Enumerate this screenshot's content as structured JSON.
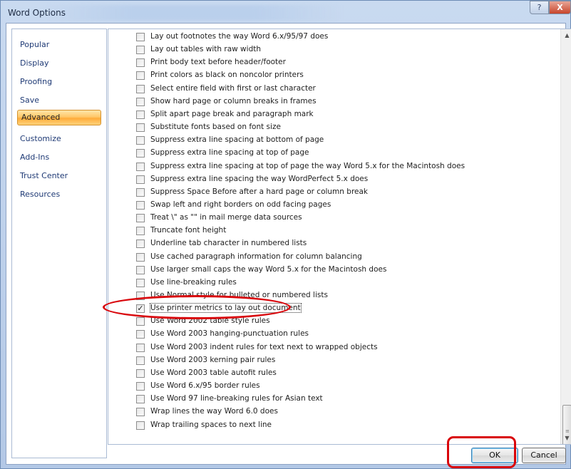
{
  "window": {
    "title": "Word Options",
    "help_glyph": "?",
    "close_glyph": "X"
  },
  "nav": {
    "items": [
      {
        "label": "Popular"
      },
      {
        "label": "Display"
      },
      {
        "label": "Proofing"
      },
      {
        "label": "Save"
      },
      {
        "label": "Advanced",
        "selected": true
      },
      {
        "label": "Customize"
      },
      {
        "label": "Add-Ins"
      },
      {
        "label": "Trust Center"
      },
      {
        "label": "Resources"
      }
    ]
  },
  "options": [
    {
      "label": "Lay out footnotes the way Word 6.x/95/97 does",
      "checked": false
    },
    {
      "label": "Lay out tables with raw width",
      "checked": false
    },
    {
      "label": "Print body text before header/footer",
      "checked": false
    },
    {
      "label": "Print colors as black on noncolor printers",
      "checked": false
    },
    {
      "label": "Select entire field with first or last character",
      "checked": false
    },
    {
      "label": "Show hard page or column breaks in frames",
      "checked": false
    },
    {
      "label": "Split apart page break and paragraph mark",
      "checked": false
    },
    {
      "label": "Substitute fonts based on font size",
      "checked": false
    },
    {
      "label": "Suppress extra line spacing at bottom of page",
      "checked": false
    },
    {
      "label": "Suppress extra line spacing at top of page",
      "checked": false
    },
    {
      "label": "Suppress extra line spacing at top of page the way Word 5.x for the Macintosh does",
      "checked": false
    },
    {
      "label": "Suppress extra line spacing the way WordPerfect 5.x does",
      "checked": false
    },
    {
      "label": "Suppress Space Before after a hard page or column break",
      "checked": false
    },
    {
      "label": "Swap left and right borders on odd facing pages",
      "checked": false
    },
    {
      "label": "Treat \\\" as \"\" in mail merge data sources",
      "checked": false
    },
    {
      "label": "Truncate font height",
      "checked": false
    },
    {
      "label": "Underline tab character in numbered lists",
      "checked": false
    },
    {
      "label": "Use cached paragraph information for column balancing",
      "checked": false
    },
    {
      "label": "Use larger small caps the way Word 5.x for the Macintosh does",
      "checked": false
    },
    {
      "label": "Use line-breaking rules",
      "checked": false
    },
    {
      "label": "Use Normal style for bulleted or numbered lists",
      "checked": false
    },
    {
      "label": "Use printer metrics to lay out document",
      "checked": true,
      "focused": true
    },
    {
      "label": "Use Word 2002 table style rules",
      "checked": false
    },
    {
      "label": "Use Word 2003 hanging-punctuation rules",
      "checked": false
    },
    {
      "label": "Use Word 2003 indent rules for text next to wrapped objects",
      "checked": false
    },
    {
      "label": "Use Word 2003 kerning pair rules",
      "checked": false
    },
    {
      "label": "Use Word 2003 table autofit rules",
      "checked": false
    },
    {
      "label": "Use Word 6.x/95 border rules",
      "checked": false
    },
    {
      "label": "Use Word 97 line-breaking rules for Asian text",
      "checked": false
    },
    {
      "label": "Wrap lines the way Word 6.0 does",
      "checked": false
    },
    {
      "label": "Wrap trailing spaces to next line",
      "checked": false
    }
  ],
  "scrollbar": {
    "up_glyph": "▲",
    "down_glyph": "▼",
    "grip_glyph": "≡",
    "position_fraction": 1.0
  },
  "buttons": {
    "ok_label": "OK",
    "cancel_label": "Cancel"
  },
  "colors": {
    "annotation": "#d9060b",
    "selected_nav": "#ffac3a"
  }
}
